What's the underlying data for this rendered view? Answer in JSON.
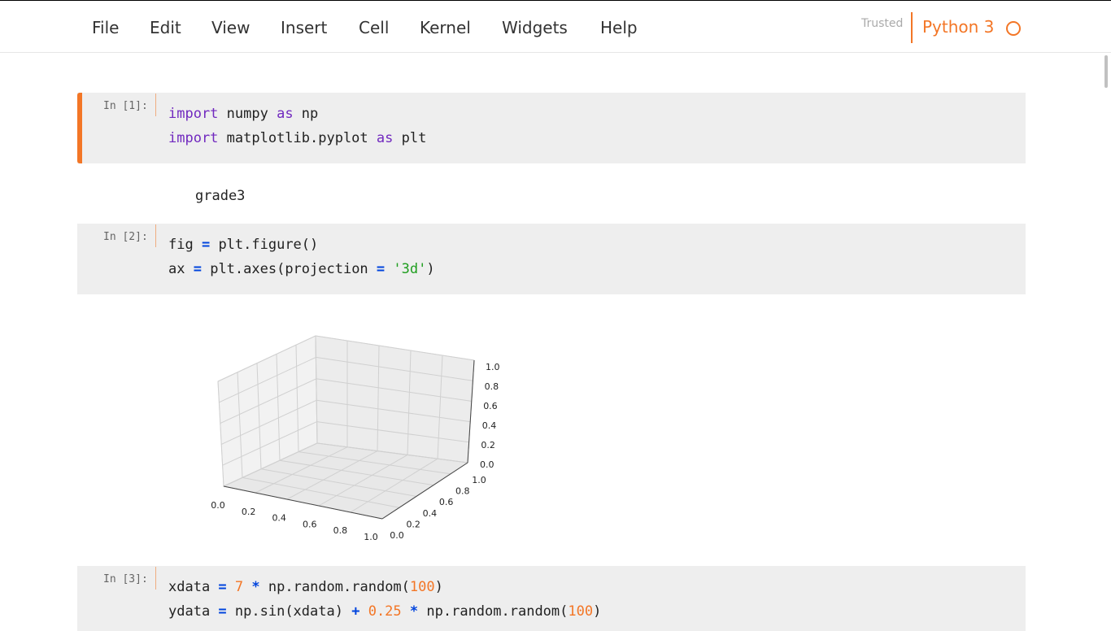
{
  "menubar": {
    "items": [
      "File",
      "Edit",
      "View",
      "Insert",
      "Cell",
      "Kernel",
      "Widgets",
      "Help"
    ],
    "trusted_label": "Trusted",
    "kernel_name": "Python 3",
    "kernel_indicator_icon": "circle-idle-icon"
  },
  "cells": [
    {
      "prompt": "In [1]:",
      "lines": [
        "import numpy as np",
        "import matplotlib.pyplot as plt"
      ]
    },
    {
      "prompt": "In [2]:",
      "lines": [
        "fig = plt.figure()",
        "ax = plt.axes(projection = '3d')"
      ]
    },
    {
      "prompt": "In [3]:",
      "lines": [
        "xdata = 7 * np.random.random(100)",
        "ydata = np.sin(xdata) + 0.25 * np.random.random(100)"
      ]
    }
  ],
  "outputs": {
    "text": "grade3"
  },
  "chart_data": {
    "type": "scatter",
    "projection": "3d",
    "title": "",
    "x_ticks": [
      "0.0",
      "0.2",
      "0.4",
      "0.6",
      "0.8",
      "1.0"
    ],
    "y_ticks": [
      "0.0",
      "0.2",
      "0.4",
      "0.6",
      "0.8",
      "1.0"
    ],
    "z_ticks": [
      "0.0",
      "0.2",
      "0.4",
      "0.6",
      "0.8",
      "1.0"
    ],
    "xlim": [
      0,
      1
    ],
    "ylim": [
      0,
      1
    ],
    "zlim": [
      0,
      1
    ],
    "grid": true,
    "series": []
  },
  "colors": {
    "accent": "#f37626",
    "keyword": "#7129bf",
    "operator": "#0044dd",
    "string": "#1f9e1f",
    "number": "#f37626",
    "cell_background": "#eeeeee"
  }
}
